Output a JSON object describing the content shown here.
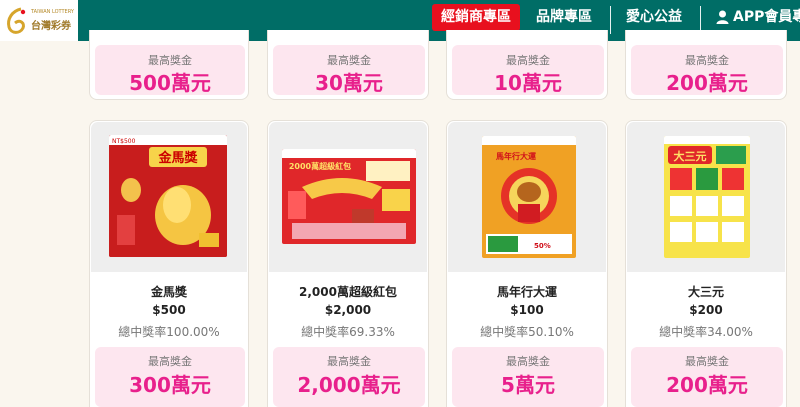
{
  "brand": {
    "name": "台灣彩券",
    "tagline": "TAIWAN LOTTERY",
    "colors": {
      "header": "#006d66",
      "accent": "#e8101e",
      "prize": "#e8208c",
      "prize_bg": "#fde6ef"
    }
  },
  "nav": {
    "items": [
      {
        "label": "經銷商專區",
        "active": true
      },
      {
        "label": "品牌專區"
      },
      {
        "label": "愛心公益"
      },
      {
        "label": "APP會員專區",
        "icon": "user-icon"
      }
    ]
  },
  "top_row": [
    {
      "prize_label": "最高獎金",
      "prize_value": "500萬元"
    },
    {
      "prize_label": "最高獎金",
      "prize_value": "30萬元"
    },
    {
      "prize_label": "最高獎金",
      "prize_value": "10萬元"
    },
    {
      "prize_label": "最高獎金",
      "prize_value": "200萬元"
    }
  ],
  "games": [
    {
      "name": "金馬獎",
      "price": "$500",
      "odds": "總中獎率100.00%",
      "prize_label": "最高獎金",
      "prize_value": "300萬元",
      "ticket_title": "金馬獎",
      "ticket_code": "NT$500"
    },
    {
      "name": "2,000萬超級紅包",
      "price": "$2,000",
      "odds": "總中獎率69.33%",
      "prize_label": "最高獎金",
      "prize_value": "2,000萬元",
      "ticket_title": "2000萬超級紅包"
    },
    {
      "name": "馬年行大運",
      "price": "$100",
      "odds": "總中獎率50.10%",
      "prize_label": "最高獎金",
      "prize_value": "5萬元",
      "ticket_title": "馬年行大運",
      "ticket_badge": "50%"
    },
    {
      "name": "大三元",
      "price": "$200",
      "odds": "總中獎率34.00%",
      "prize_label": "最高獎金",
      "prize_value": "200萬元",
      "ticket_title": "大三元"
    }
  ]
}
